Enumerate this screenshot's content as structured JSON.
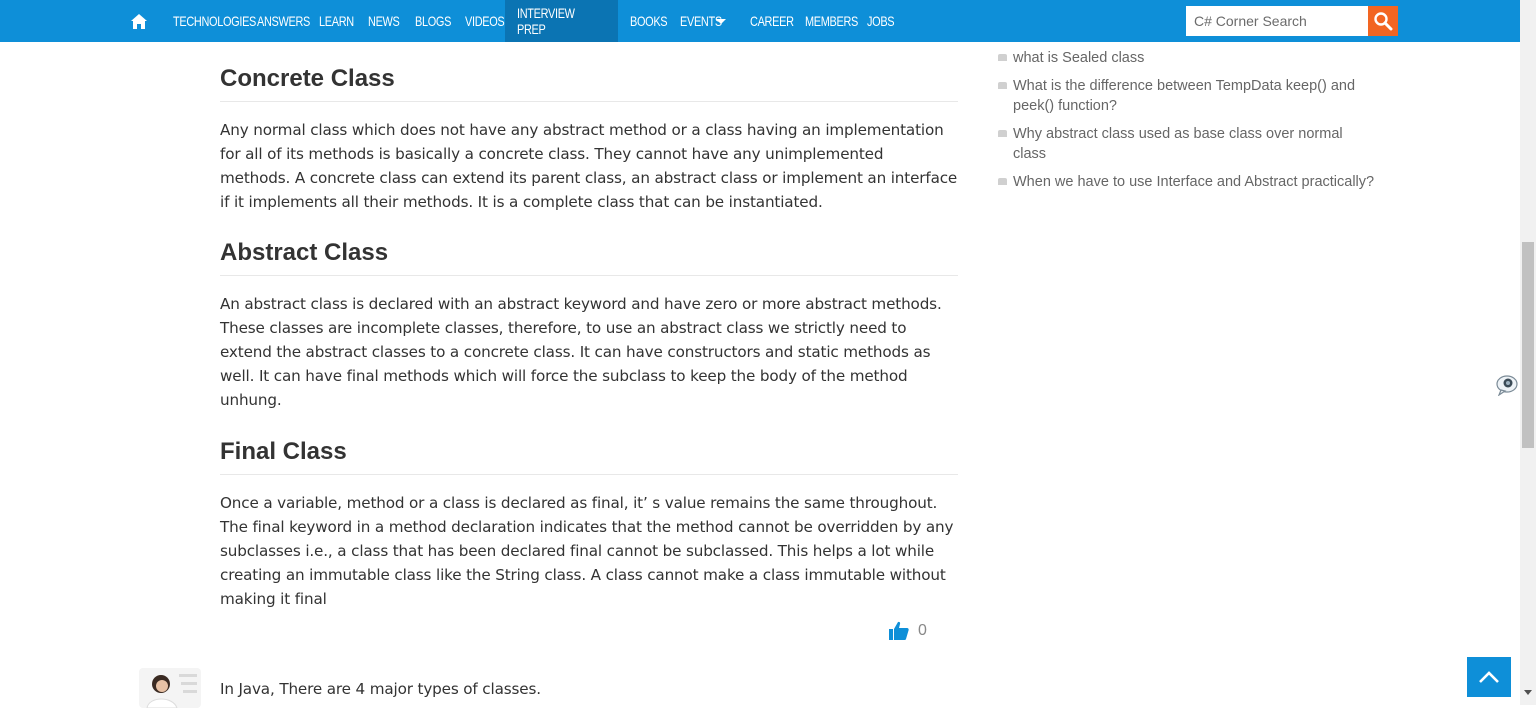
{
  "nav": {
    "items": [
      {
        "label": "TECHNOLOGIES",
        "active": false
      },
      {
        "label": "ANSWERS",
        "active": false
      },
      {
        "label": "LEARN",
        "active": false
      },
      {
        "label": "NEWS",
        "active": false
      },
      {
        "label": "BLOGS",
        "active": false
      },
      {
        "label": "VIDEOS",
        "active": false
      },
      {
        "label": "INTERVIEW PREP",
        "active": true
      },
      {
        "label": "BOOKS",
        "active": false
      },
      {
        "label": "EVENTS",
        "active": false,
        "dropdown": true
      },
      {
        "label": "CAREER",
        "active": false
      },
      {
        "label": "MEMBERS",
        "active": false
      },
      {
        "label": "JOBS",
        "active": false
      }
    ],
    "search_placeholder": "C# Corner Search"
  },
  "article": {
    "sections": [
      {
        "title": "Concrete Class",
        "body": "Any normal class which does not have any abstract method or a class having an implementation for all of its methods is basically a concrete class. They cannot have any unimplemented methods. A concrete class can extend its parent class, an abstract class or implement an interface if it implements all their methods. It is a complete class that can be instantiated."
      },
      {
        "title": "Abstract Class",
        "body": "An abstract class is declared with an abstract keyword and have zero or more abstract methods. These classes are incomplete classes, therefore, to use an abstract class we strictly need to extend the abstract classes to a concrete class. It can have constructors and static methods as well. It can have final methods which will force the subclass to keep the body of the method unhung."
      },
      {
        "title": "Final Class",
        "body": "Once a variable, method or a class is declared as final, it’   s value remains the same throughout. The final keyword in a method declaration indicates that the method cannot be overridden by any subclasses i.e., a class that has been declared final cannot be subclassed. This helps a lot while creating an immutable class like the String class. A class cannot make a class immutable without making it final"
      }
    ],
    "like_count": "0"
  },
  "next_answer": {
    "text": "In Java, There are 4 major types of classes."
  },
  "sidebar": {
    "related": [
      "what is Sealed class",
      "What is the difference between TempData keep() and peek() function?",
      "Why abstract class used as base class over normal class",
      "When we have to use Interface and Abstract practically?"
    ]
  },
  "colors": {
    "nav_bg": "#0e8fd8",
    "nav_active": "#0b74b3",
    "search_btn": "#f26522",
    "like_icon": "#0e8fd8"
  }
}
